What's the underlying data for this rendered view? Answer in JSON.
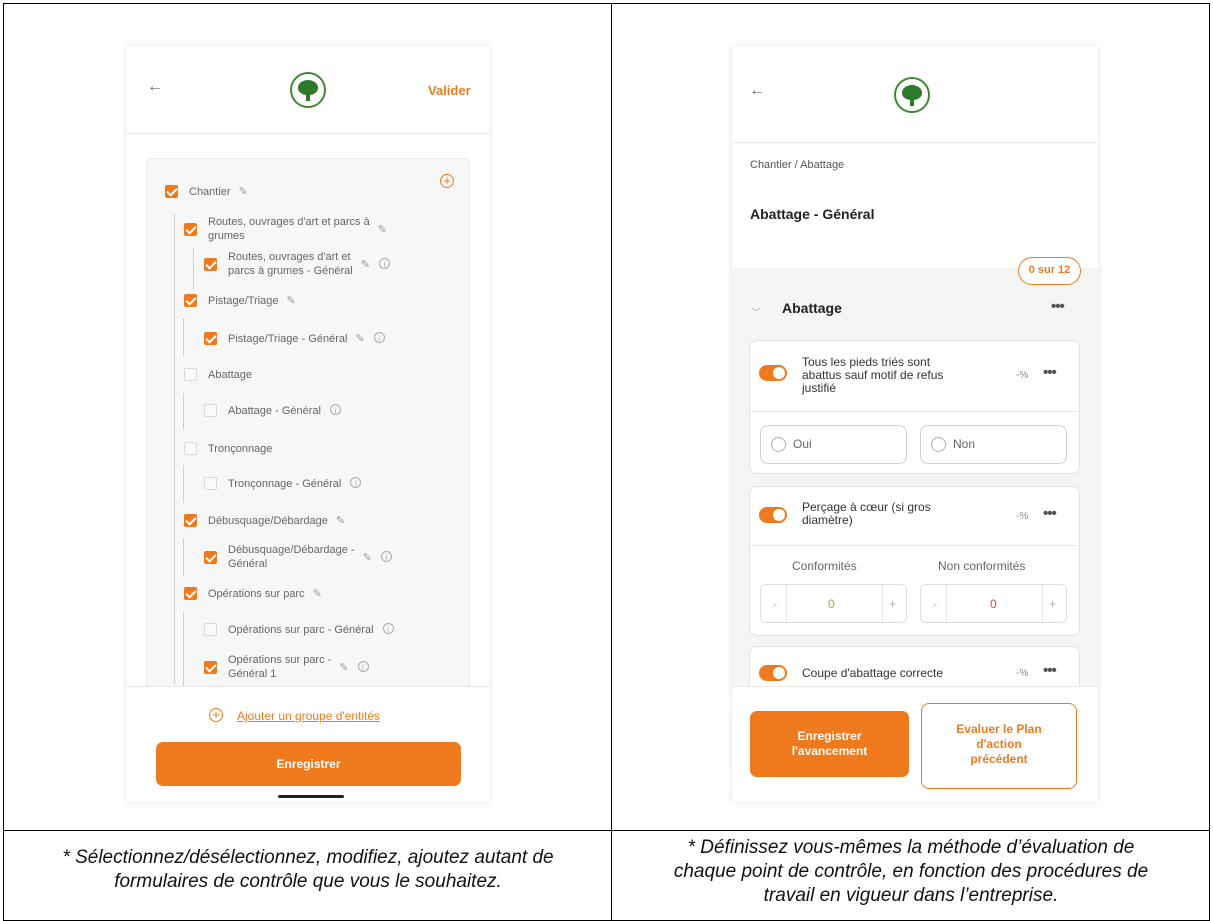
{
  "left": {
    "header": {
      "back": "←",
      "action": "Valider"
    },
    "tree": [
      {
        "label": "Chantier",
        "checked": true
      },
      {
        "label": "Routes, ouvrages d'art et parcs à",
        "label2": "grumes",
        "checked": true
      },
      {
        "label": "Routes, ouvrages d'art et",
        "label2": "parcs à grumes - Général",
        "checked": true
      },
      {
        "label": "Pistage/Triage",
        "checked": true
      },
      {
        "label": "Pistage/Triage - Général",
        "checked": true
      },
      {
        "label": "Abattage",
        "checked": false
      },
      {
        "label": "Abattage - Général",
        "checked": false
      },
      {
        "label": "Tronçonnage",
        "checked": false
      },
      {
        "label": "Tronçonnage - Général",
        "checked": false
      },
      {
        "label": "Débusquage/Débardage",
        "checked": true
      },
      {
        "label": "Débusquage/Débardage -",
        "label2": "Général",
        "checked": true
      },
      {
        "label": "Opérations sur parc",
        "checked": true
      },
      {
        "label": "Opérations sur parc - Général",
        "checked": false
      },
      {
        "label": "Opérations sur parc -",
        "label2": "Général 1",
        "checked": true
      }
    ],
    "add_group": "Ajouter un groupe d'entités",
    "save": "Enregistrer"
  },
  "right": {
    "header": {
      "back": "←"
    },
    "breadcrumb": "Chantier / Abattage",
    "title": "Abattage - Général",
    "badge": "0 sur 12",
    "section": "Abattage",
    "cards": [
      {
        "title1": "Tous les pieds triés sont",
        "title2": "abattus sauf motif de refus",
        "title3": "justifié",
        "pct": "-%",
        "options": [
          "Oui",
          "Non"
        ]
      },
      {
        "title1": "Perçage à cœur (si gros",
        "title2": "diamètre)",
        "pct": "-%",
        "conformites_label": "Conformités",
        "non_conformites_label": "Non conformités",
        "conformites_value": "0",
        "non_conformites_value": "0",
        "minus": "-",
        "plus": "+"
      },
      {
        "title1": "Coupe d'abattage correcte",
        "pct": "-%"
      }
    ],
    "btn_save": "Enregistrer l'avancement",
    "btn_save_1": "Enregistrer",
    "btn_save_2": "l'avancement",
    "btn_eval_1": "Evaluer le Plan",
    "btn_eval_2": "d'action",
    "btn_eval_3": "précédent"
  },
  "captions": {
    "left_1": "* Sélectionnez/désélectionnez, modifiez, ajoutez autant de",
    "left_2": "formulaires de contrôle que vous le souhaitez.",
    "right_1": "* Définissez vous-mêmes la méthode d’évaluation de",
    "right_2": "chaque point de contrôle, en fonction des procédures de",
    "right_3": "travail en vigueur dans l’entreprise."
  },
  "colors": {
    "accent": "#ef7a1e",
    "logo_green": "#2f7a2a"
  }
}
